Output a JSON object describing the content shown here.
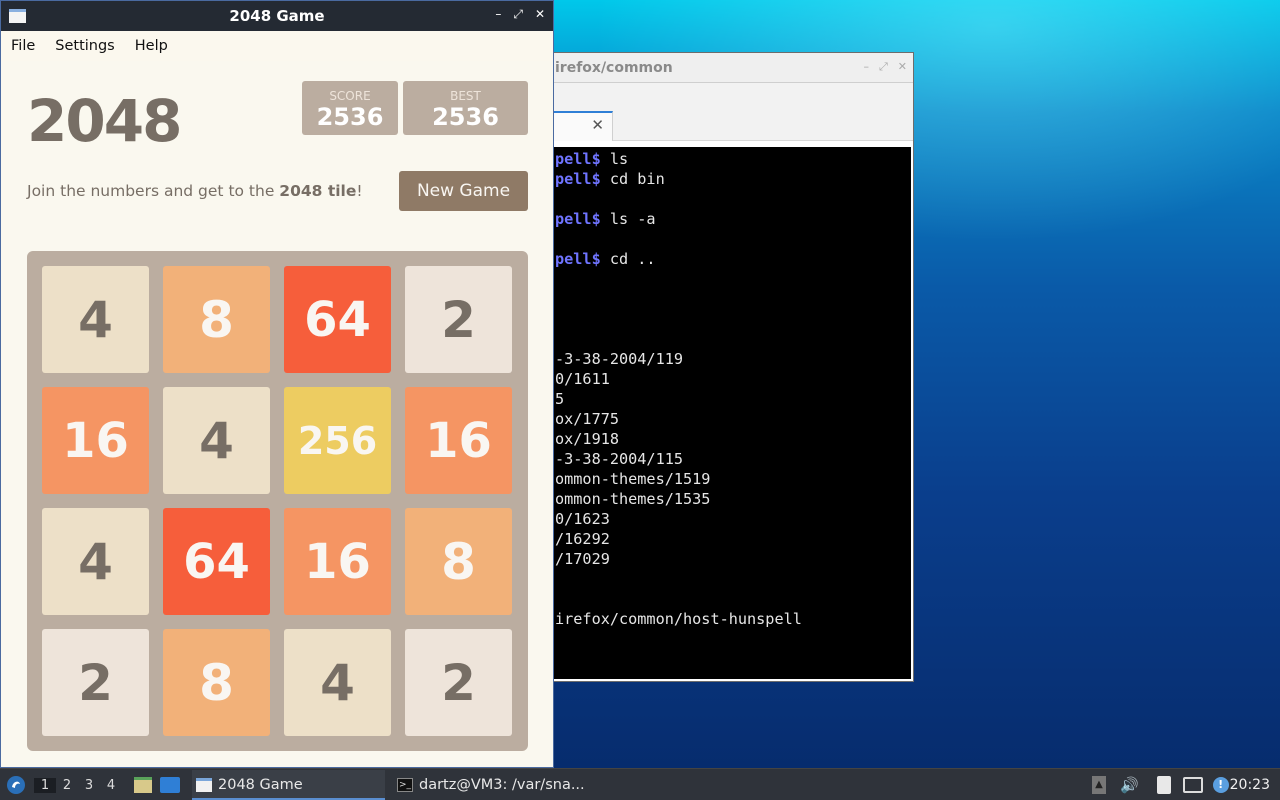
{
  "game_window": {
    "title": "2048 Game",
    "menu": [
      "File",
      "Settings",
      "Help"
    ],
    "game_title": "2048",
    "score_label": "SCORE",
    "score": "2536",
    "best_label": "BEST",
    "best": "2536",
    "intro_text": "Join the numbers and get to the ",
    "intro_bold": "2048 tile",
    "intro_end": "!",
    "new_game_label": "New Game",
    "grid": [
      [
        "4",
        "8",
        "64",
        "2"
      ],
      [
        "16",
        "4",
        "256",
        "16"
      ],
      [
        "4",
        "64",
        "16",
        "8"
      ],
      [
        "2",
        "8",
        "4",
        "2"
      ]
    ]
  },
  "terminal_window": {
    "title": "irefox/common",
    "lines": [
      {
        "prompt": "pell$",
        "text": " ls"
      },
      {
        "prompt": "pell$",
        "text": " cd bin"
      },
      {
        "prompt": "",
        "text": ""
      },
      {
        "prompt": "pell$",
        "text": " ls -a"
      },
      {
        "prompt": "",
        "text": ""
      },
      {
        "prompt": "pell$",
        "text": " cd .."
      },
      {
        "prompt": "",
        "text": ""
      },
      {
        "prompt": "",
        "text": ""
      },
      {
        "prompt": "",
        "text": ""
      },
      {
        "prompt": "",
        "text": ""
      },
      {
        "prompt": "",
        "text": "-3-38-2004/119"
      },
      {
        "prompt": "",
        "text": "0/1611"
      },
      {
        "prompt": "",
        "text": "5"
      },
      {
        "prompt": "",
        "text": "ox/1775"
      },
      {
        "prompt": "",
        "text": "ox/1918"
      },
      {
        "prompt": "",
        "text": "-3-38-2004/115"
      },
      {
        "prompt": "",
        "text": "ommon-themes/1519"
      },
      {
        "prompt": "",
        "text": "ommon-themes/1535"
      },
      {
        "prompt": "",
        "text": "0/1623"
      },
      {
        "prompt": "",
        "text": "/16292"
      },
      {
        "prompt": "",
        "text": "/17029"
      },
      {
        "prompt": "",
        "text": ""
      },
      {
        "prompt": "",
        "text": ""
      },
      {
        "prompt": "",
        "text": "irefox/common/host-hunspell"
      }
    ]
  },
  "taskbar": {
    "workspaces": [
      "1",
      "2",
      "3",
      "4"
    ],
    "tasks": [
      "2048 Game",
      "dartz@VM3: /var/sna..."
    ],
    "clock": "20:23"
  },
  "colors": {
    "tile_2": "#eee4da",
    "tile_4": "#ede0c8",
    "tile_8": "#f2b179",
    "tile_16": "#f59563",
    "tile_64": "#f65e3b",
    "tile_256": "#edcc61"
  }
}
